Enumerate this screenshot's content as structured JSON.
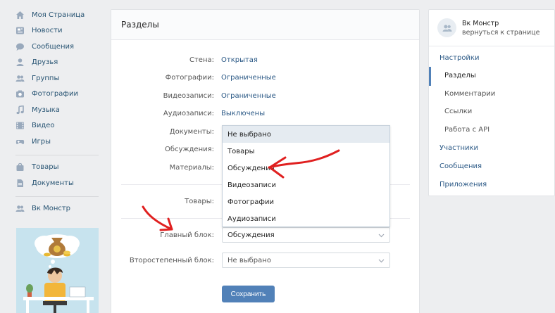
{
  "leftnav": {
    "items": [
      {
        "label": "Моя Страница",
        "icon": "home-icon"
      },
      {
        "label": "Новости",
        "icon": "news-icon"
      },
      {
        "label": "Сообщения",
        "icon": "messages-icon"
      },
      {
        "label": "Друзья",
        "icon": "friends-icon"
      },
      {
        "label": "Группы",
        "icon": "groups-icon"
      },
      {
        "label": "Фотографии",
        "icon": "camera-icon"
      },
      {
        "label": "Музыка",
        "icon": "music-icon"
      },
      {
        "label": "Видео",
        "icon": "video-icon"
      },
      {
        "label": "Игры",
        "icon": "games-icon"
      }
    ],
    "items2": [
      {
        "label": "Товары",
        "icon": "bag-icon"
      },
      {
        "label": "Документы",
        "icon": "document-icon"
      }
    ],
    "items3": [
      {
        "label": "Вк Монстр",
        "icon": "group-icon"
      }
    ]
  },
  "main": {
    "title": "Разделы",
    "sections": [
      {
        "label": "Стена:",
        "value": "Открытая"
      },
      {
        "label": "Фотографии:",
        "value": "Ограниченные"
      },
      {
        "label": "Видеозаписи:",
        "value": "Ограниченные"
      },
      {
        "label": "Аудиозаписи:",
        "value": "Выключены"
      }
    ],
    "documents_label": "Документы:",
    "discussions_label": "Обсуждения:",
    "materials_label": "Материалы:",
    "goods_label": "Товары:",
    "main_block_label": "Главный блок:",
    "main_block_value": "Обсуждения",
    "secondary_block_label": "Второстепенный блок:",
    "secondary_block_value": "Не выбрано",
    "dropdown_options": [
      "Не выбрано",
      "Товары",
      "Обсуждения",
      "Видеозаписи",
      "Фотографии",
      "Аудиозаписи"
    ],
    "save_label": "Сохранить"
  },
  "right": {
    "group_name": "Вк Монстр",
    "back_link": "вернуться к странице",
    "menu": {
      "settings": "Настройки",
      "sections": "Разделы",
      "comments": "Комментарии",
      "links": "Ссылки",
      "api": "Работа с API",
      "members": "Участники",
      "messages": "Сообщения",
      "apps": "Приложения"
    }
  },
  "colors": {
    "accent": "#5181b8",
    "link": "#2a5885",
    "annotation": "#e02020"
  }
}
